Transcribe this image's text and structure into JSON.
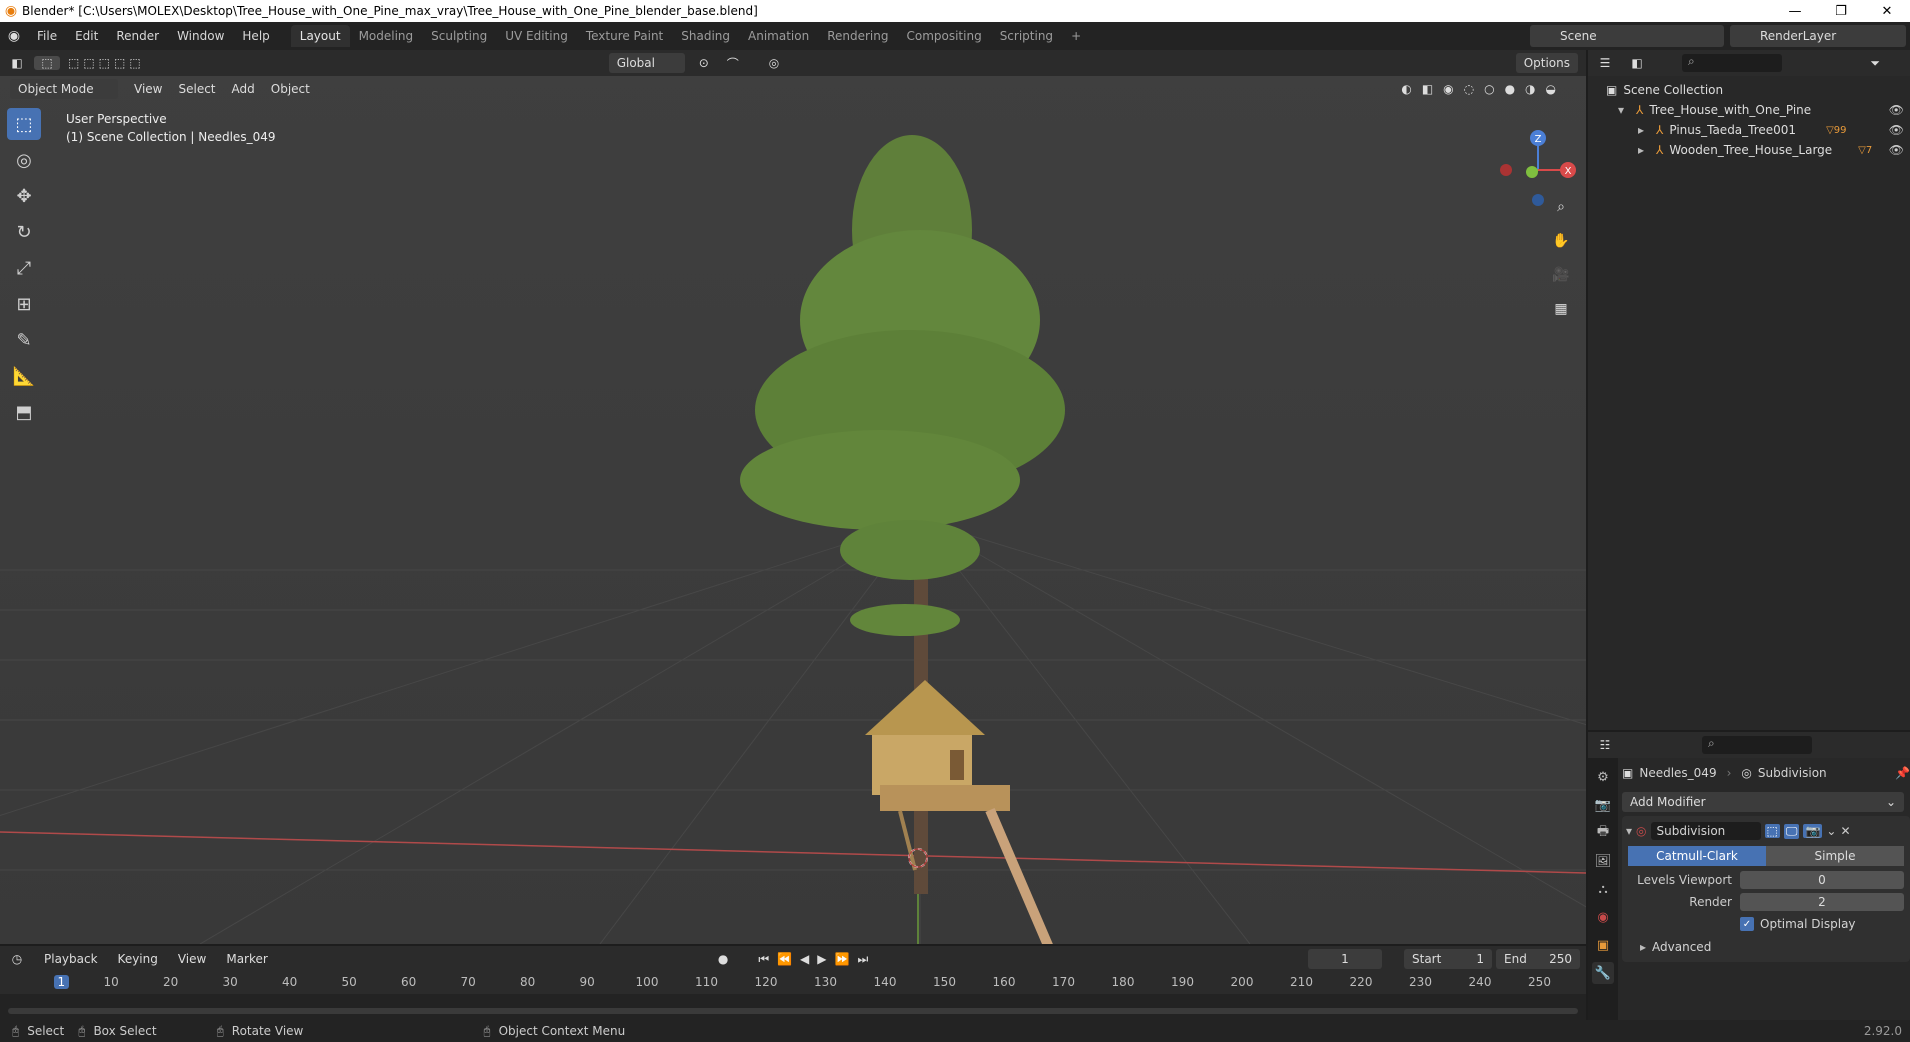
{
  "window": {
    "title": "Blender* [C:\\Users\\MOLEX\\Desktop\\Tree_House_with_One_Pine_max_vray\\Tree_House_with_One_Pine_blender_base.blend]",
    "minimize": "—",
    "restore": "❐",
    "close": "✕"
  },
  "menubar": {
    "items": [
      "File",
      "Edit",
      "Render",
      "Window",
      "Help"
    ]
  },
  "workspaces": {
    "tabs": [
      "Layout",
      "Modeling",
      "Sculpting",
      "UV Editing",
      "Texture Paint",
      "Shading",
      "Animation",
      "Rendering",
      "Compositing",
      "Scripting"
    ],
    "active": "Layout",
    "add": "+"
  },
  "scene": {
    "name": "Scene",
    "render_layer": "RenderLayer"
  },
  "viewport": {
    "transform_orientation": "Global",
    "options_label": "Options",
    "mode": "Object Mode",
    "menu": [
      "View",
      "Select",
      "Add",
      "Object"
    ],
    "info_line1": "User Perspective",
    "info_line2": "(1) Scene Collection | Needles_049",
    "gizmo": {
      "z": "Z",
      "x": "X"
    }
  },
  "outliner": {
    "root": "Scene Collection",
    "items": [
      {
        "label": "Tree_House_with_One_Pine",
        "depth": 1
      },
      {
        "label": "Pinus_Taeda_Tree001",
        "depth": 2,
        "badge": "99"
      },
      {
        "label": "Wooden_Tree_House_Large",
        "depth": 2,
        "badge": "7"
      }
    ]
  },
  "properties": {
    "object_name": "Needles_049",
    "modifier_ref": "Subdivision",
    "add_modifier": "Add Modifier",
    "modifier": {
      "name": "Subdivision",
      "algorithms": [
        "Catmull-Clark",
        "Simple"
      ],
      "active_algorithm": "Catmull-Clark",
      "levels_viewport_label": "Levels Viewport",
      "levels_viewport": "0",
      "render_label": "Render",
      "render": "2",
      "optimal_display_label": "Optimal Display",
      "optimal_display": true,
      "advanced_label": "Advanced"
    }
  },
  "timeline": {
    "menu": [
      "Playback",
      "Keying",
      "View",
      "Marker"
    ],
    "current_frame": "1",
    "start_label": "Start",
    "start": "1",
    "end_label": "End",
    "end": "250",
    "ruler": [
      "1",
      "10",
      "20",
      "30",
      "40",
      "50",
      "60",
      "70",
      "80",
      "90",
      "100",
      "110",
      "120",
      "130",
      "140",
      "150",
      "160",
      "170",
      "180",
      "190",
      "200",
      "210",
      "220",
      "230",
      "240",
      "250"
    ]
  },
  "statusbar": {
    "select": "Select",
    "box_select": "Box Select",
    "rotate_view": "Rotate View",
    "context_menu": "Object Context Menu",
    "version": "2.92.0"
  },
  "colors": {
    "accent": "#4772b3",
    "blender_orange": "#e87d0d",
    "viewport_bg": "#3d3d3d",
    "x_axis": "#d94a4a",
    "y_axis": "#7fbf3f",
    "z_axis": "#4b7fd6"
  }
}
